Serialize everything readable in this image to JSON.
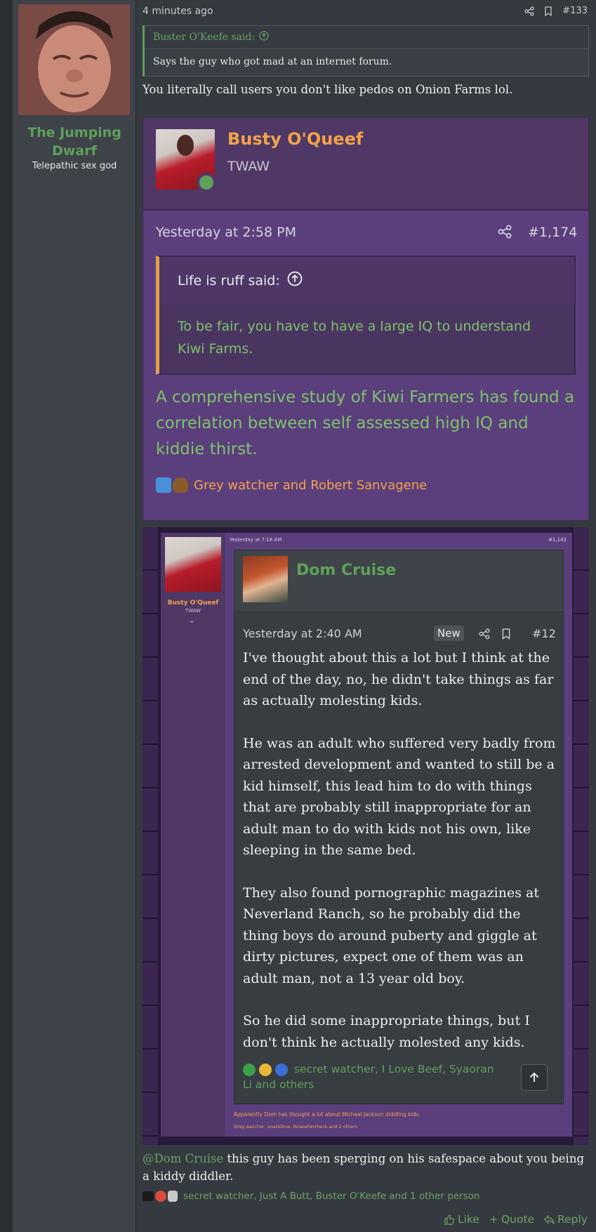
{
  "post": {
    "author": "The Jumping Dwarf",
    "user_title": "Telepathic sex god",
    "time": "4 minutes ago",
    "post_number": "#133",
    "quote_author": "Buster O'Keefe said:",
    "quote_text": "Says the guy who got mad at an internet forum.",
    "reply_line": "You literally call users you don't like pedos on Onion Farms lol.",
    "mention": "@Dom Cruise",
    "body_after_mention": " this guy has been sperging on his safespace about you being a kiddy diddler.",
    "reactions_text": "secret watcher, Just A Butt, Buster O'Keefe and 1 other person",
    "actions": {
      "like": "Like",
      "quote": "Quote",
      "reply": "Reply"
    }
  },
  "embed1": {
    "author": "Busty O'Queef",
    "title": "TWAW",
    "time": "Yesterday at 2:58 PM",
    "post_number": "#1,174",
    "quote_author": "Life is ruff said:",
    "quote_text": "To be fair, you have to have a large IQ to understand Kiwi Farms.",
    "body": "A comprehensive study of Kiwi Farmers has found a correlation between self assessed high IQ and kiddie thirst.",
    "reactions_text": "Grey watcher and Robert Sanvagene"
  },
  "embed2": {
    "outer_author": "Busty O'Queef",
    "outer_title": "TWAW",
    "outer_time": "Yesterday at 7:18 AM",
    "outer_post_number": "#1,142",
    "inner_author": "Dom Cruise",
    "inner_time": "Yesterday at 2:40 AM",
    "inner_badge": "New",
    "inner_post_number": "#12",
    "paragraphs": [
      "I've thought about this a lot but I think at the end of the day, no, he didn't take things as far as actually molesting kids.",
      "He was an adult who suffered very badly from arrested development and wanted to still be a kid himself, this lead him to do with things that are probably still inappropriate for an adult man to do with kids not his own, like sleeping in the same bed.",
      "They also found pornographic magazines at Neverland Ranch, so he probably did the thing boys do around puberty and giggle at dirty pictures, expect one of them was an adult man, not a 13 year old boy.",
      "So he did some inappropriate things, but I don't think he actually molested any kids."
    ],
    "inner_reactions_text": "secret watcher, I Love Beef, Syaoran Li and others",
    "outer_caption": "Apparently Dom has thought a lot about Michael Jackson diddling kids.",
    "outer_reactions_text": "Grey watcher, snailslime, RoseaPanthera and 2 others"
  },
  "colors": {
    "green": "#5fa05a",
    "orange": "#f2a24a",
    "purple": "#5b3f7d",
    "bg": "#353a40"
  }
}
